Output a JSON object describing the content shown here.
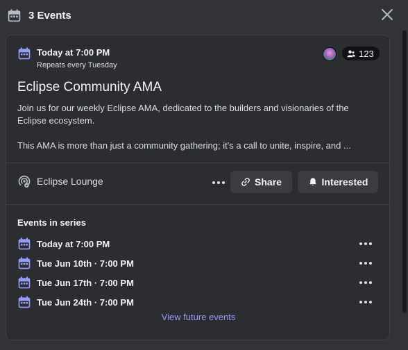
{
  "header": {
    "title": "3 Events",
    "icon": "calendar-icon"
  },
  "event": {
    "time": "Today at 7:00 PM",
    "repeat": "Repeats every Tuesday",
    "interested_count": "123",
    "title": "Eclipse Community AMA",
    "description_1": "Join us for our weekly Eclipse AMA, dedicated to the builders and visionaries of the Eclipse ecosystem.",
    "description_2": "This AMA is more than just a community gathering; it's a call to unite, inspire, and ...",
    "location": "Eclipse Lounge",
    "share_label": "Share",
    "interested_label": "Interested"
  },
  "series": {
    "title": "Events in series",
    "items": [
      {
        "label": "Today at 7:00 PM"
      },
      {
        "label": "Tue Jun 10th · 7:00 PM"
      },
      {
        "label": "Tue Jun 17th · 7:00 PM"
      },
      {
        "label": "Tue Jun 24th · 7:00 PM"
      }
    ],
    "view_more": "View future events"
  },
  "colors": {
    "background": "#313338",
    "card": "#2b2d31",
    "calendar_accent": "#949cf7",
    "link": "#949cf7"
  }
}
